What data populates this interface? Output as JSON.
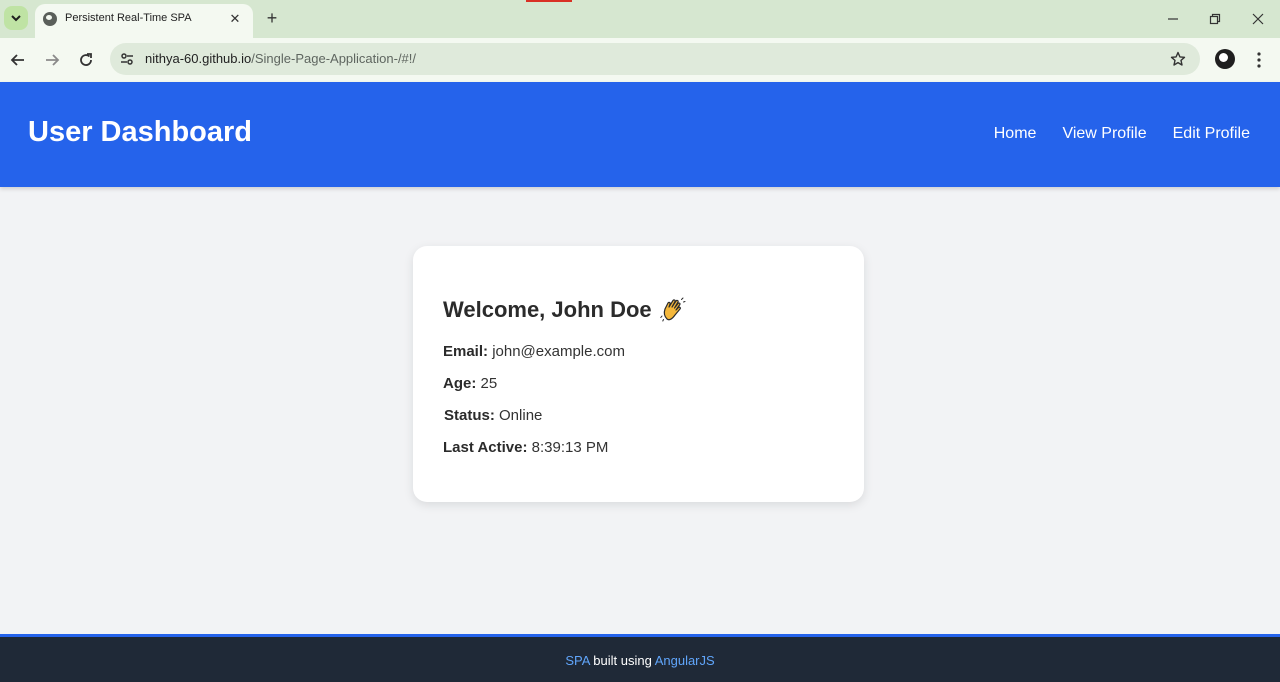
{
  "browser": {
    "tab_title": "Persistent Real-Time SPA",
    "url_host": "nithya-60.github.io",
    "url_path": "/Single-Page-Application-/#!/",
    "icons": {
      "tab_search": "chevron-down-icon",
      "favicon": "globe-icon",
      "tab_close": "close-icon",
      "new_tab": "plus-icon",
      "back": "arrow-left-icon",
      "forward": "arrow-right-icon",
      "reload": "reload-icon",
      "site_info": "tune-icon",
      "bookmark": "star-icon",
      "profile": "avatar-icon",
      "menu": "more-vert-icon",
      "minimize": "minimize-icon",
      "restore": "restore-icon",
      "close": "close-icon"
    }
  },
  "header": {
    "title": "User Dashboard",
    "nav": [
      "Home",
      "View Profile",
      "Edit Profile"
    ]
  },
  "card": {
    "welcome": "Welcome, John Doe",
    "fields": [
      {
        "label": "Email:",
        "value": "john@example.com"
      },
      {
        "label": "Age:",
        "value": "25"
      },
      {
        "label": "Status:",
        "value": "Online"
      },
      {
        "label": "Last Active:",
        "value": "8:39:13 PM"
      }
    ]
  },
  "footer": {
    "link1": "SPA",
    "middle": " built using ",
    "link2": "AngularJS"
  },
  "colors": {
    "header_bg": "#2563eb",
    "footer_bg": "#1f2937",
    "footer_link": "#60a5fa",
    "page_bg": "#f2f3f5"
  }
}
